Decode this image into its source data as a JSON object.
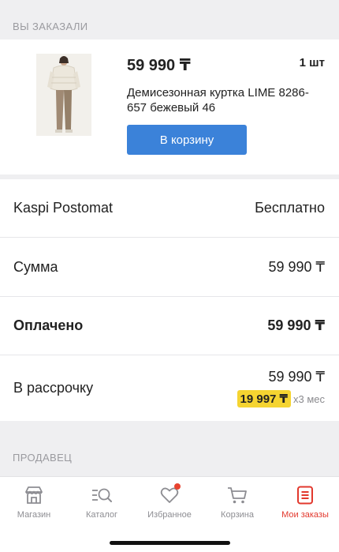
{
  "order_section": {
    "header": "ВЫ ЗАКАЗАЛИ",
    "item": {
      "price": "59 990 ₸",
      "quantity": "1 шт",
      "name": "Демисезонная куртка LIME 8286-657 бежевый 46",
      "add_to_cart_label": "В корзину"
    }
  },
  "summary": {
    "delivery": {
      "label": "Kaspi Postomat",
      "value": "Бесплатно"
    },
    "sum": {
      "label": "Сумма",
      "value": "59 990 ₸"
    },
    "paid": {
      "label": "Оплачено",
      "value": "59 990 ₸"
    },
    "installment": {
      "label": "В рассрочку",
      "total": "59 990 ₸",
      "monthly": "19 997 ₸",
      "months": "x3 мес"
    }
  },
  "seller_section": {
    "header": "ПРОДАВЕЦ"
  },
  "tabbar": {
    "tabs": [
      {
        "label": "Магазин",
        "icon": "shop-icon"
      },
      {
        "label": "Каталог",
        "icon": "catalog-search-icon"
      },
      {
        "label": "Избранное",
        "icon": "heart-icon"
      },
      {
        "label": "Корзина",
        "icon": "cart-icon"
      },
      {
        "label": "Мои заказы",
        "icon": "orders-icon",
        "active": true
      }
    ]
  },
  "colors": {
    "accent_blue": "#3b82d9",
    "active_red": "#e2382d",
    "installment_yellow": "#f5d431",
    "background": "#efeff1"
  }
}
